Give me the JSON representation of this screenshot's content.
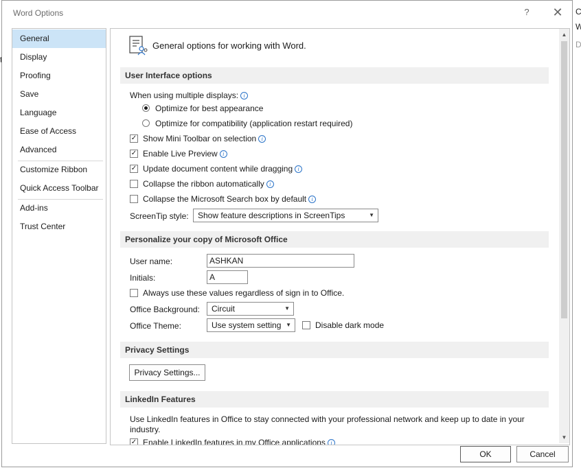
{
  "window": {
    "title": "Word Options",
    "help": "?",
    "close": "✕"
  },
  "background": {
    "right_chars": [
      "C",
      "W",
      "D"
    ],
    "left_char": "ti"
  },
  "nav": {
    "items": [
      "General",
      "Display",
      "Proofing",
      "Save",
      "Language",
      "Ease of Access",
      "Advanced",
      "Customize Ribbon",
      "Quick Access Toolbar",
      "Add-ins",
      "Trust Center"
    ],
    "selected": "General"
  },
  "header": {
    "text": "General options for working with Word."
  },
  "ui_options": {
    "title": "User Interface options",
    "multi_display_label": "When using multiple displays:",
    "radio_best": "Optimize for best appearance",
    "radio_compat": "Optimize for compatibility (application restart required)",
    "mini_toolbar": "Show Mini Toolbar on selection",
    "live_preview": "Enable Live Preview",
    "update_dragging": "Update document content while dragging",
    "collapse_ribbon": "Collapse the ribbon automatically",
    "collapse_search": "Collapse the Microsoft Search box by default",
    "screentip_label": "ScreenTip style:",
    "screentip_value": "Show feature descriptions in ScreenTips"
  },
  "personalize": {
    "title": "Personalize your copy of Microsoft Office",
    "username_label": "User name:",
    "username_value": "ASHKAN",
    "initials_label": "Initials:",
    "initials_value": "A",
    "always_use": "Always use these values regardless of sign in to Office.",
    "background_label": "Office Background:",
    "background_value": "Circuit",
    "theme_label": "Office Theme:",
    "theme_value": "Use system setting",
    "dark_mode": "Disable dark mode"
  },
  "privacy": {
    "title": "Privacy Settings",
    "button": "Privacy Settings..."
  },
  "linkedin": {
    "title": "LinkedIn Features",
    "description": "Use LinkedIn features in Office to stay connected with your professional network and keep up to date in your industry.",
    "enable": "Enable LinkedIn features in my Office applications"
  },
  "footer": {
    "ok": "OK",
    "cancel": "Cancel"
  },
  "icons": {
    "checkmark": "✓",
    "scroll_up": "▲",
    "scroll_down": "▼",
    "dropdown": "▼",
    "info": "i"
  }
}
